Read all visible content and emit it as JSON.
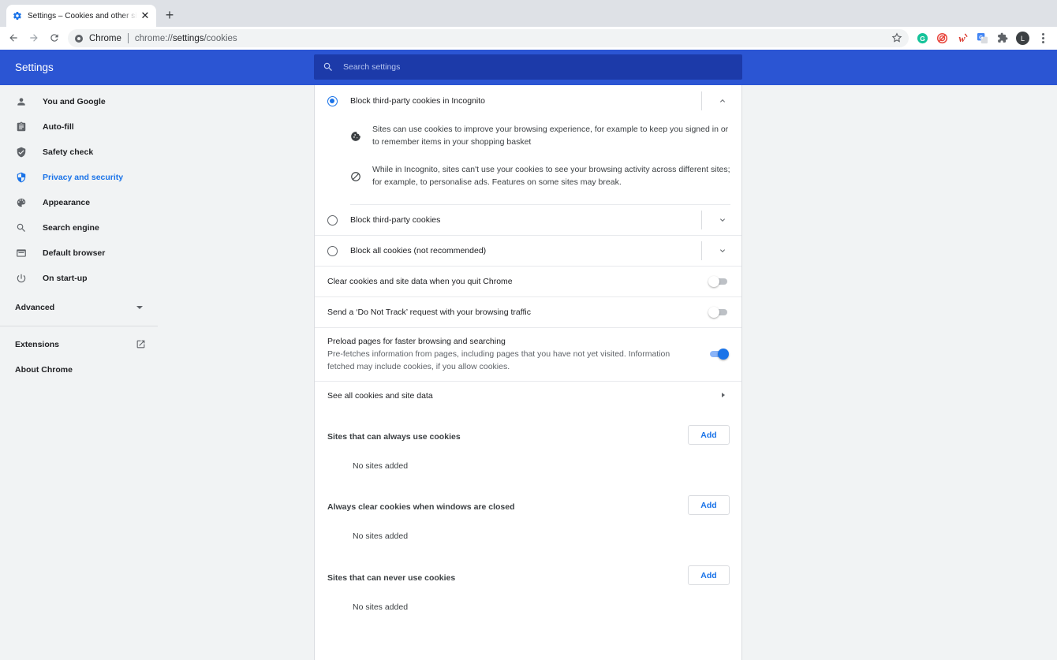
{
  "tab": {
    "title": "Settings – Cookies and other site data",
    "close": "✕",
    "new_tab": "+"
  },
  "omnibox": {
    "site_label": "Chrome",
    "url_prefix": "chrome://",
    "url_host": "settings",
    "url_path": "/cookies"
  },
  "profile": {
    "initial": "L"
  },
  "extensions": [
    {
      "name": "grammarly-icon",
      "color": "#15c39a"
    },
    {
      "name": "target-extension-icon",
      "color": "#e8453c"
    },
    {
      "name": "w-extension-icon",
      "color": "#d93025"
    },
    {
      "name": "translate-icon",
      "color": "#4285f4"
    },
    {
      "name": "puzzle-icon",
      "color": "#5f6368"
    }
  ],
  "header": {
    "title": "Settings",
    "search_placeholder": "Search settings"
  },
  "sidebar": {
    "items": [
      {
        "label": "You and Google",
        "icon": "person-icon"
      },
      {
        "label": "Auto-fill",
        "icon": "clipboard-icon"
      },
      {
        "label": "Safety check",
        "icon": "shield-check-icon"
      },
      {
        "label": "Privacy and security",
        "icon": "shield-icon",
        "active": true
      },
      {
        "label": "Appearance",
        "icon": "palette-icon"
      },
      {
        "label": "Search engine",
        "icon": "search-icon"
      },
      {
        "label": "Default browser",
        "icon": "browser-icon"
      },
      {
        "label": "On start-up",
        "icon": "power-icon"
      }
    ],
    "advanced": "Advanced",
    "extensions": "Extensions",
    "about": "About Chrome"
  },
  "cookies": {
    "incognito": {
      "label": "Block third-party cookies in Incognito",
      "selected": true,
      "details": [
        "Sites can use cookies to improve your browsing experience, for example to keep you signed in or to remember items in your shopping basket",
        "While in Incognito, sites can't use your cookies to see your browsing activity across different sites; for example, to personalise ads. Features on some sites may break."
      ]
    },
    "third_party": {
      "label": "Block third-party cookies"
    },
    "block_all": {
      "label": "Block all cookies (not recommended)"
    },
    "clear_on_quit": {
      "label": "Clear cookies and site data when you quit Chrome",
      "enabled": false
    },
    "do_not_track": {
      "label": "Send a ‘Do Not Track’ request with your browsing traffic",
      "enabled": false
    },
    "preload": {
      "label": "Preload pages for faster browsing and searching",
      "description": "Pre-fetches information from pages, including pages that you have not yet visited. Information fetched may include cookies, if you allow cookies.",
      "enabled": true
    },
    "see_all": "See all cookies and site data",
    "lists": [
      {
        "title": "Sites that can always use cookies",
        "add": "Add",
        "empty": "No sites added"
      },
      {
        "title": "Always clear cookies when windows are closed",
        "add": "Add",
        "empty": "No sites added"
      },
      {
        "title": "Sites that can never use cookies",
        "add": "Add",
        "empty": "No sites added"
      }
    ]
  }
}
